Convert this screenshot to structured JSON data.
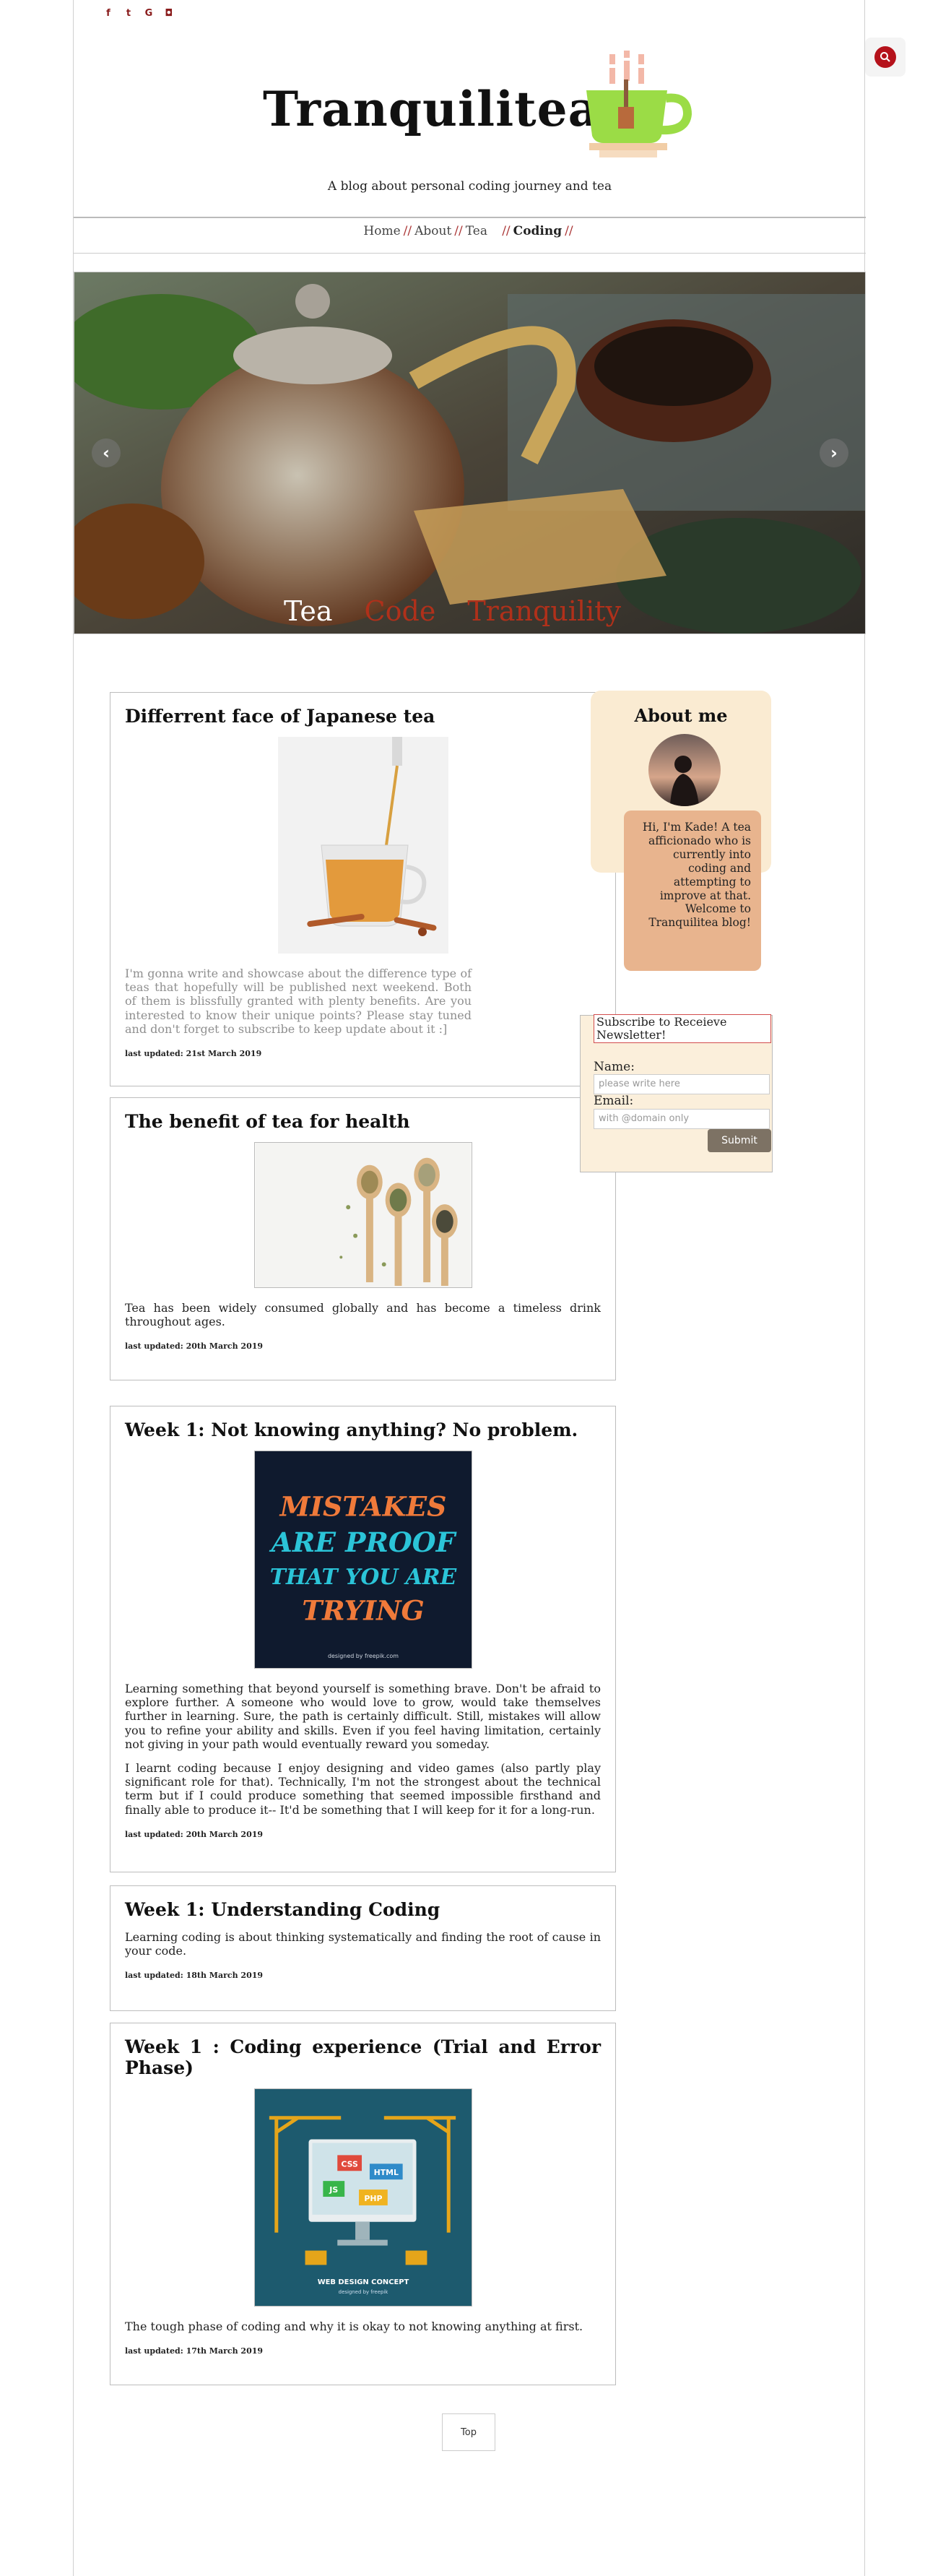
{
  "social": {
    "icons": [
      "facebook-icon",
      "twitter-icon",
      "google-icon",
      "instagram-icon"
    ],
    "glyphs": [
      "f",
      "t",
      "G",
      "◘"
    ]
  },
  "header": {
    "brand": "Tranquilitea",
    "tagline": "A blog about personal coding journey and tea"
  },
  "nav": {
    "items": [
      {
        "label": "Home"
      },
      {
        "label": "About"
      },
      {
        "label": "Tea"
      },
      {
        "label": "Coding"
      }
    ],
    "separator": "//",
    "active": "Coding"
  },
  "hero": {
    "words": [
      "Tea",
      "Code",
      "Tranquility"
    ],
    "prev": "‹",
    "next": "›"
  },
  "posts": [
    {
      "title": "Differrent face of Japanese tea",
      "body": "I'm gonna write and showcase about the difference type of teas that hopefully will be published next weekend. Both of them is blissfully granted with plenty benefits. Are you interested to know their unique points? Please stay tuned and don't forget to subscribe to keep update about it :]",
      "date": "last updated: 21st March 2019"
    },
    {
      "title": "The benefit of tea for health",
      "body": "Tea has been widely consumed globally and has become a timeless drink throughout ages.",
      "date": "last updated: 20th March 2019"
    },
    {
      "title": "Week 1: Not knowing anything? No problem.",
      "body": "Learning something that beyond yourself is something brave. Don't be afraid to explore further. A someone who would love to grow, would take themselves further in learning. Sure, the path is certainly difficult. Still, mistakes will allow you to refine your ability and skills. Even if you feel having limitation, certainly not giving in your path would eventually reward you someday.",
      "body2": "I learnt coding because I enjoy designing and video games (also partly play significant role for that). Technically, I'm not the strongest about the technical term but if I could produce something that seemed impossible firsthand and finally able to produce it-- It'd be something that I will keep for it for a long-run.",
      "image_text": [
        "MISTAKES",
        "ARE PROOF",
        "THAT YOU ARE",
        "TRYING",
        "designed by freepik.com"
      ],
      "date": "last updated: 20th March 2019"
    },
    {
      "title": "Week 1: Understanding Coding",
      "body": "Learning coding is about thinking systematically and finding the root of cause in your code.",
      "date": "last updated: 18th March 2019"
    },
    {
      "title": "Week 1 : Coding experience (Trial and Error Phase)",
      "body": "The tough phase of coding and why it is okay to not knowing anything at first.",
      "image_text": [
        "CSS",
        "HTML",
        "JS",
        "PHP",
        "WEB DESIGN CONCEPT",
        "designed by freepik"
      ],
      "date": "last updated: 17th March 2019"
    }
  ],
  "sidebar": {
    "about_title": "About me",
    "about_text": "Hi, I'm Kade! A tea afficionado who is currently into coding and attempting to improve at that. Welcome to Tranquilitea blog!",
    "subscribe_title": "Subscribe to Receieve Newsletter!",
    "name_label": "Name:",
    "name_placeholder": "please write here",
    "email_label": "Email:",
    "email_placeholder": "with @domain only",
    "submit_label": "Submit"
  },
  "footer": {
    "top_label": "Top"
  }
}
